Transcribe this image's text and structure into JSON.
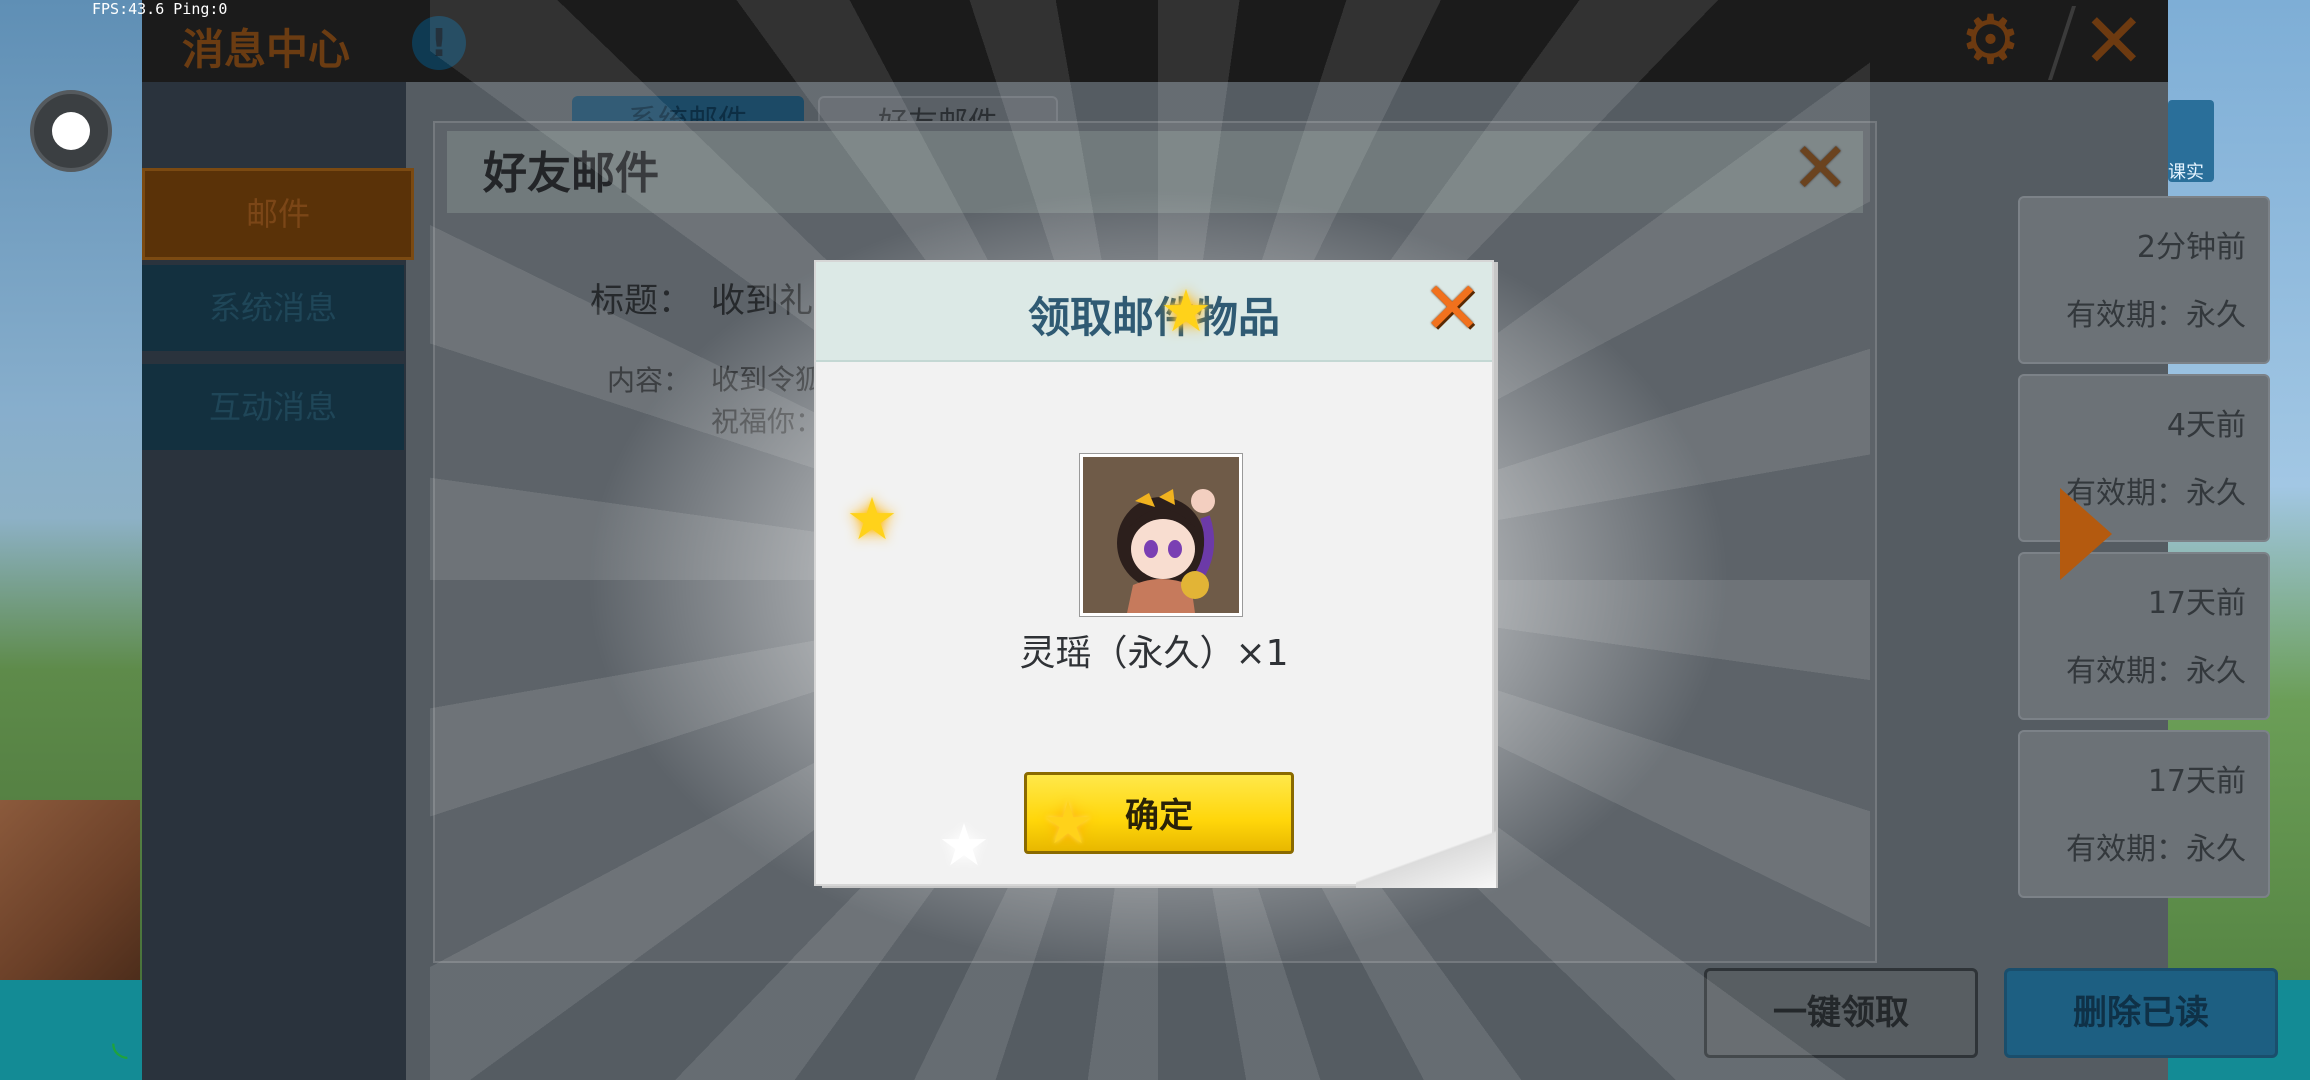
{
  "overlay": {
    "fps_text": "FPS:43.6  Ping:0",
    "record_icon": "record-icon",
    "wifi_icon": "wifi-icon"
  },
  "message_center": {
    "title": "消息中心",
    "alert_icon": "!",
    "gear_icon": "gear-icon",
    "close_icon": "✕",
    "sidebar": [
      {
        "label": "邮件"
      },
      {
        "label": "系统消息"
      },
      {
        "label": "互动消息"
      }
    ],
    "subtabs": [
      {
        "label": "系统邮件"
      },
      {
        "label": "好友邮件"
      }
    ],
    "mail_list": [
      {
        "time": "2分钟前",
        "validity": "有效期：永久"
      },
      {
        "time": "4天前",
        "validity": "有效期：永久"
      },
      {
        "time": "17天前",
        "validity": "有效期：永久"
      },
      {
        "time": "17天前",
        "validity": "有效期：永久"
      }
    ],
    "right_avatar_label": "课实",
    "buttons": {
      "claim_all": "一键领取",
      "delete_read": "删除已读"
    }
  },
  "friend_mail": {
    "title": "好友邮件",
    "close_icon": "✕",
    "subject_label": "标题：",
    "subject_value": "收到礼",
    "content_label": "内容：",
    "content_line1": "收到令狐",
    "content_line2": "祝福你："
  },
  "reward_popup": {
    "title": "领取邮件物品",
    "close_icon": "✕",
    "item_name": "灵瑶（永久）×1",
    "confirm_label": "确定",
    "accent_yellow": "#ffd60a",
    "accent_orange": "#f1711d"
  }
}
